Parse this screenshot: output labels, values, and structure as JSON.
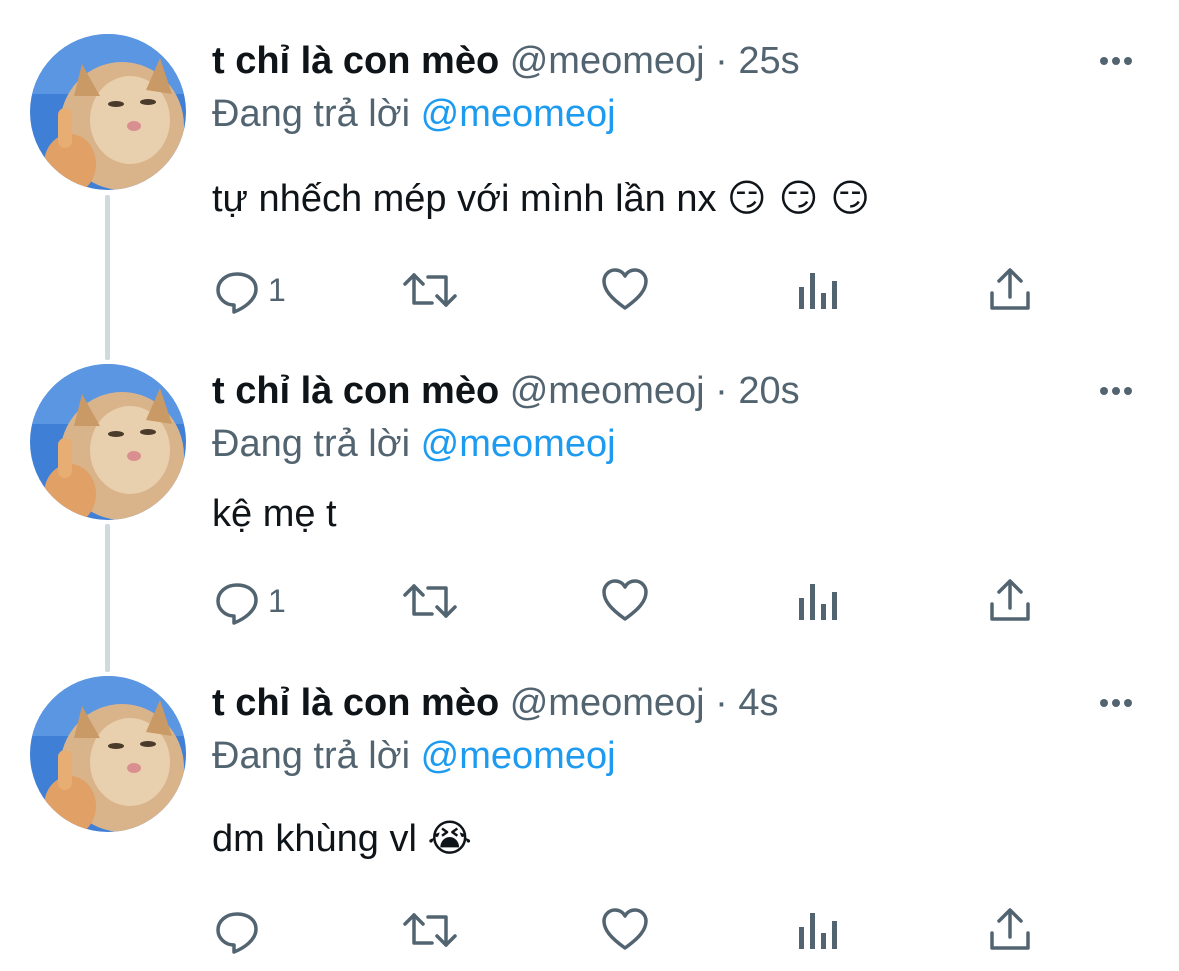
{
  "tweets": [
    {
      "name": "t chỉ là con mèo",
      "handle": "@meomeoj",
      "separator": " · ",
      "time": "25s",
      "replying_prefix": "Đang trả lời ",
      "replying_to": "@meomeoj",
      "text": "tự nhếch mép với mình lần nx",
      "emojis": "😏 😏 😏",
      "reply_count": "1"
    },
    {
      "name": "t chỉ là con mèo",
      "handle": "@meomeoj",
      "separator": " · ",
      "time": "20s",
      "replying_prefix": "Đang trả lời ",
      "replying_to": "@meomeoj",
      "text": "kệ mẹ t",
      "emojis": "",
      "reply_count": "1"
    },
    {
      "name": "t chỉ là con mèo",
      "handle": "@meomeoj",
      "separator": " · ",
      "time": "4s",
      "replying_prefix": "Đang trả lời ",
      "replying_to": "@meomeoj",
      "text": "dm khùng vl",
      "emojis": "😭",
      "reply_count": ""
    }
  ],
  "icons": {
    "reply": "reply-icon",
    "retweet": "retweet-icon",
    "like": "like-icon",
    "views": "views-icon",
    "share": "share-icon",
    "more": "more-icon"
  },
  "colors": {
    "text": "#0f1419",
    "secondary": "#536471",
    "link": "#1d9bf0",
    "thread_line": "#cfd9de"
  }
}
